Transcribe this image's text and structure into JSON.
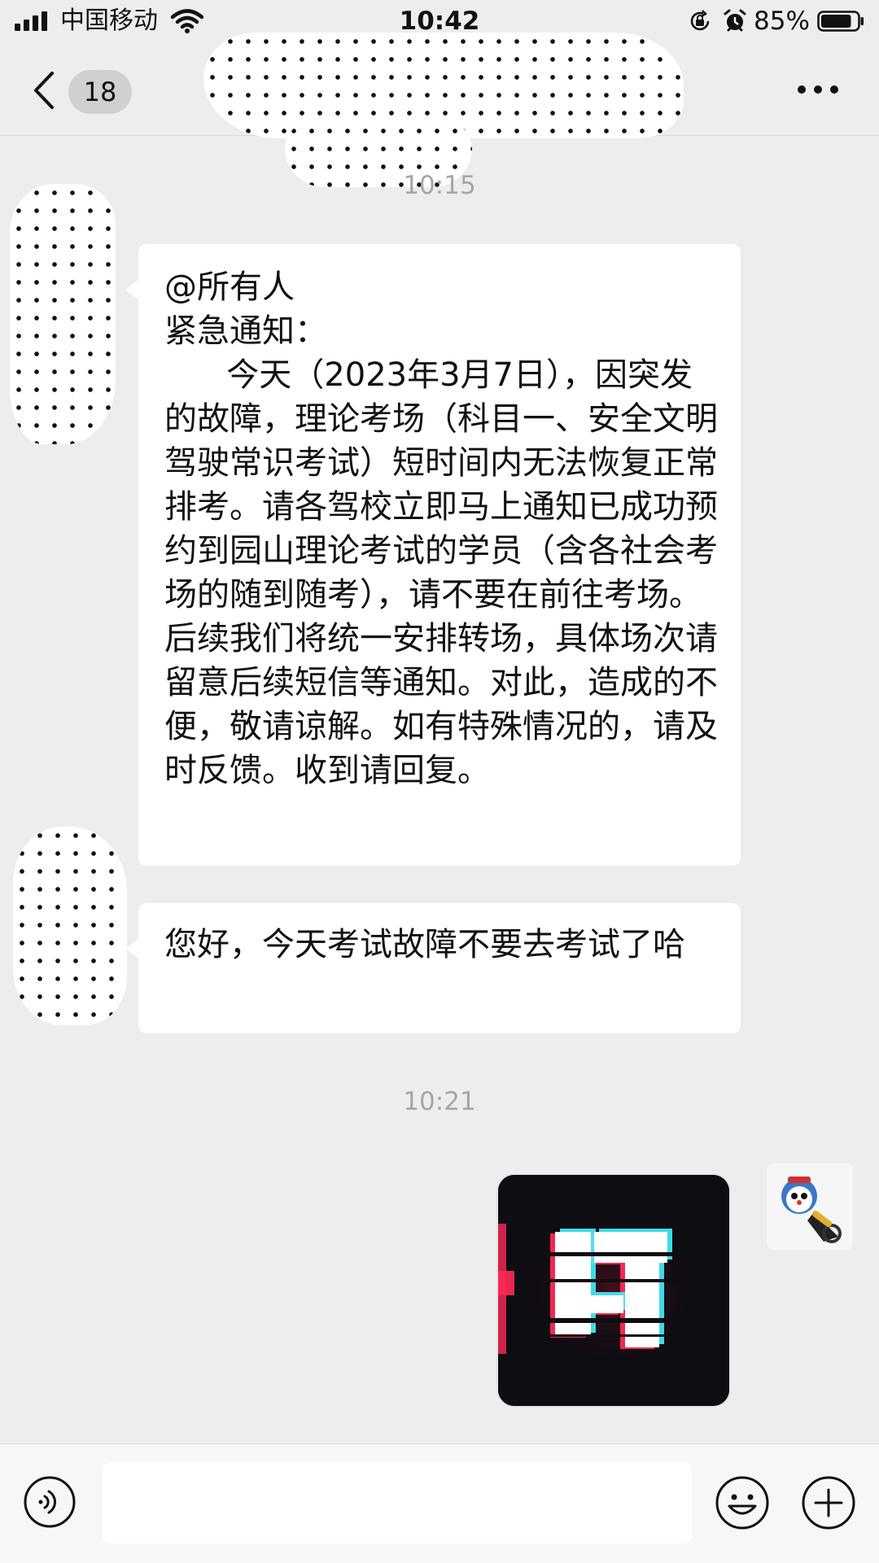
{
  "status_bar": {
    "carrier": "中国移动",
    "time": "10:42",
    "battery_percent": "85%",
    "battery_level": 0.85,
    "icons": [
      "signal-icon",
      "wifi-icon",
      "orientation-lock-icon",
      "alarm-icon",
      "battery-icon"
    ]
  },
  "nav": {
    "unread_count": "18",
    "icons": [
      "back-chevron-icon",
      "more-dots-icon"
    ]
  },
  "messages": {
    "time_1": "10:15",
    "msg_1": "@所有人\n紧急通知：\n      今天（2023年3月7日），因突发的故障，理论考场（科目一、安全文明驾驶常识考试）短时间内无法恢复正常排考。请各驾校立即马上通知已成功预约到园山理论考试的学员（含各社会考场的随到随考），请不要在前往考场。后续我们将统一安排转场，具体场次请留意后续短信等通知。对此，造成的不便，敬请谅解。如有特殊情况的，请及时反馈。收到请回复。",
    "msg_2": "您好，今天考试故障不要去考试了哈",
    "time_2": "10:21"
  },
  "colors": {
    "background": "#ededed",
    "bubble": "#ffffff",
    "timestamp": "#a6a6a6",
    "glitch_red": "#ff2a55",
    "glitch_cyan": "#41f2ff"
  },
  "input_bar": {
    "text_value": "",
    "icons": [
      "voice-icon",
      "emoji-icon",
      "plus-icon"
    ]
  }
}
